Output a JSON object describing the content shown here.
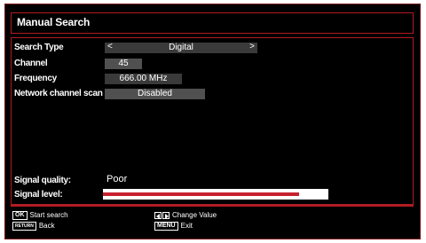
{
  "title": "Manual Search",
  "fields": {
    "search_type": {
      "label": "Search Type",
      "value": "Digital"
    },
    "channel": {
      "label": "Channel",
      "value": "45"
    },
    "frequency": {
      "label": "Frequency",
      "value": "666.00 MHz"
    },
    "network_scan": {
      "label": "Network channel scan",
      "value": "Disabled"
    }
  },
  "signal": {
    "quality_label": "Signal quality:",
    "quality_value": "Poor",
    "level_label": "Signal level:",
    "level_fraction": 0.87,
    "level_color": "#c8202e"
  },
  "footer": {
    "ok_key": "OK",
    "ok_text": "Start search",
    "back_key": "RETURN",
    "back_text": "Back",
    "lr_text": "Change Value",
    "menu_key": "MENU",
    "menu_text": "Exit"
  },
  "colors": {
    "accent_border": "#b31b22",
    "background": "#000000"
  }
}
